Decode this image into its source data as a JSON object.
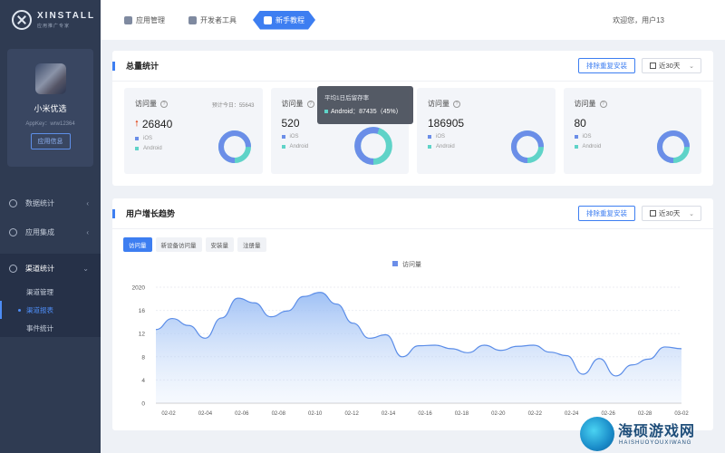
{
  "brand": {
    "title": "XINSTALL",
    "subtitle": "应用推广专家"
  },
  "app": {
    "name": "小米优选",
    "appkey": "AppKey：wrw12364",
    "info_button": "应用信息"
  },
  "sidebar": {
    "items": [
      {
        "label": "数据统计",
        "icon": "chart-icon",
        "chevron": "‹"
      },
      {
        "label": "应用集成",
        "icon": "integration-icon",
        "chevron": "‹"
      },
      {
        "label": "渠道统计",
        "icon": "channel-icon",
        "chevron": "⌄"
      }
    ],
    "subitems": [
      "渠道管理",
      "渠道报表",
      "事件统计"
    ]
  },
  "topbar": {
    "tabs": [
      {
        "label": "应用管理",
        "icon": "cube-icon"
      },
      {
        "label": "开发者工具",
        "icon": "toolbox-icon"
      },
      {
        "label": "新手教程",
        "icon": "book-icon",
        "active": true
      }
    ],
    "welcome": "欢迎您，用户13"
  },
  "summary": {
    "title": "总量统计",
    "dedupe_button": "排除重复安装",
    "range": "近30天",
    "cards": [
      {
        "label": "访问量",
        "forecast": "预计今日：55643",
        "value": "26840",
        "trend": "up",
        "ios": "iOS",
        "android": "Android",
        "ios_share": 0.75
      },
      {
        "label": "访问量",
        "value": "520",
        "ios": "iOS",
        "android": "Android",
        "ios_share": 0.55
      },
      {
        "label": "访问量",
        "value": "186905",
        "ios": "iOS",
        "android": "Android",
        "ios_share": 0.75
      },
      {
        "label": "访问量",
        "value": "80",
        "ios": "iOS",
        "android": "Android",
        "ios_share": 0.75
      }
    ],
    "tooltip": {
      "title": "平均1日后留存率",
      "line": "Android：87435（45%）"
    }
  },
  "growth": {
    "title": "用户增长趋势",
    "dedupe_button": "排除重复安装",
    "range": "近30天",
    "tabs": [
      "访问量",
      "新设备访问量",
      "安装量",
      "注册量"
    ]
  },
  "colors": {
    "accent": "#3d7ef1",
    "ios": "#6b8ee8",
    "android": "#5fd3c8",
    "sidebar": "#2f3b52"
  },
  "chart_data": {
    "type": "area",
    "legend": [
      "访问量"
    ],
    "x": [
      "02-02",
      "02-04",
      "02-06",
      "02-08",
      "02-10",
      "02-12",
      "02-14",
      "02-16",
      "02-18",
      "02-20",
      "02-22",
      "02-24",
      "02-26",
      "02-28",
      "03-02"
    ],
    "y_ticks": [
      0,
      4,
      8,
      12,
      16,
      2020
    ],
    "ylim": [
      0,
      20
    ],
    "series": [
      {
        "name": "访问量",
        "values": [
          12.7,
          14.6,
          13.4,
          11.2,
          14.7,
          18.1,
          17.3,
          14.9,
          15.9,
          18.4,
          19.1,
          17.1,
          13.8,
          11.2,
          11.8,
          8.0,
          9.9,
          10.0,
          9.4,
          8.7,
          10.0,
          9.1,
          9.8,
          10.0,
          8.8,
          8.2,
          5.0,
          7.7,
          4.7,
          6.6,
          7.6,
          9.7,
          9.4
        ]
      }
    ]
  },
  "watermark": {
    "title": "海硕游戏网",
    "url": "HAISHUOYOUXIWANG"
  }
}
